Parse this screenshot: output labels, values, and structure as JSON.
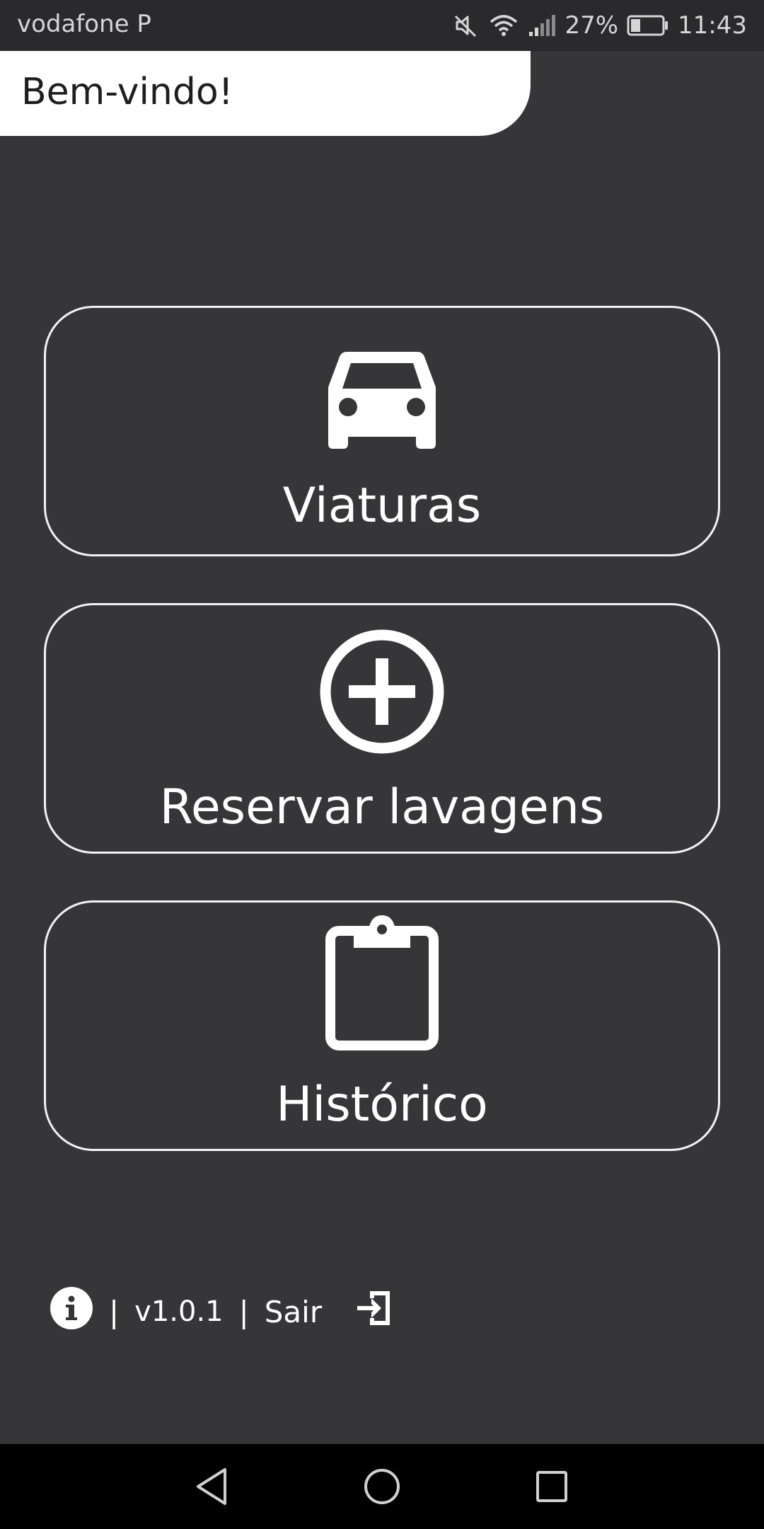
{
  "status_bar": {
    "carrier": "vodafone P",
    "battery": "27%",
    "time": "11:43",
    "icons": [
      "mute-icon",
      "wifi-icon",
      "signal-icon",
      "battery-icon"
    ]
  },
  "header": {
    "welcome": "Bem-vindo!"
  },
  "menu": {
    "items": [
      {
        "label": "Viaturas",
        "icon": "car-icon"
      },
      {
        "label": "Reservar lavagens",
        "icon": "add-circle-icon"
      },
      {
        "label": "Histórico",
        "icon": "clipboard-icon"
      }
    ]
  },
  "footer": {
    "separator": "|",
    "version": "v1.0.1",
    "exit_label": "Sair",
    "icons": [
      "info-icon",
      "exit-icon"
    ]
  },
  "navigation": {
    "icons": [
      "back-icon",
      "home-icon",
      "recent-apps-icon"
    ]
  },
  "colors": {
    "background": "#363638",
    "status_bar": "#2a2a2c",
    "foreground": "#ffffff",
    "nav_bar": "#000000"
  }
}
